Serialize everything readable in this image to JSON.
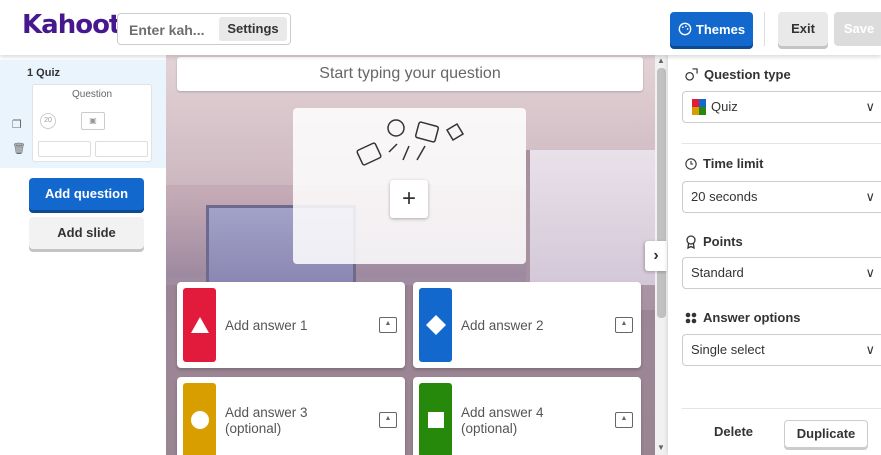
{
  "header": {
    "logo": "Kahoot!",
    "title_placeholder": "Enter kah...",
    "settings_label": "Settings",
    "themes_label": "Themes",
    "exit_label": "Exit",
    "save_label": "Save"
  },
  "sidebar": {
    "slide_label": "1 Quiz",
    "thumb_question": "Question",
    "thumb_timer": "20",
    "add_question_label": "Add question",
    "add_slide_label": "Add slide"
  },
  "editor": {
    "question_placeholder": "Start typing your question",
    "media_add_symbol": "+",
    "answers": [
      {
        "text": "Add answer 1",
        "color": "#e21b3c",
        "shape": "triangle"
      },
      {
        "text": "Add answer 2",
        "color": "#1368ce",
        "shape": "diamond"
      },
      {
        "text": "Add answer 3 (optional)",
        "color": "#d89e00",
        "shape": "circle"
      },
      {
        "text": "Add answer 4 (optional)",
        "color": "#26890c",
        "shape": "square"
      }
    ]
  },
  "rightpanel": {
    "question_type_label": "Question type",
    "question_type_value": "Quiz",
    "time_limit_label": "Time limit",
    "time_limit_value": "20 seconds",
    "points_label": "Points",
    "points_value": "Standard",
    "answer_options_label": "Answer options",
    "answer_options_value": "Single select",
    "delete_label": "Delete",
    "duplicate_label": "Duplicate"
  },
  "icons": {
    "question_type_icon": "shapes-icon",
    "time_limit_icon": "clock-icon",
    "points_icon": "medal-icon",
    "answer_options_icon": "dots-grid-icon",
    "themes_icon": "palette-icon"
  },
  "colors": {
    "brand": "#46178f",
    "primary": "#1368ce"
  }
}
